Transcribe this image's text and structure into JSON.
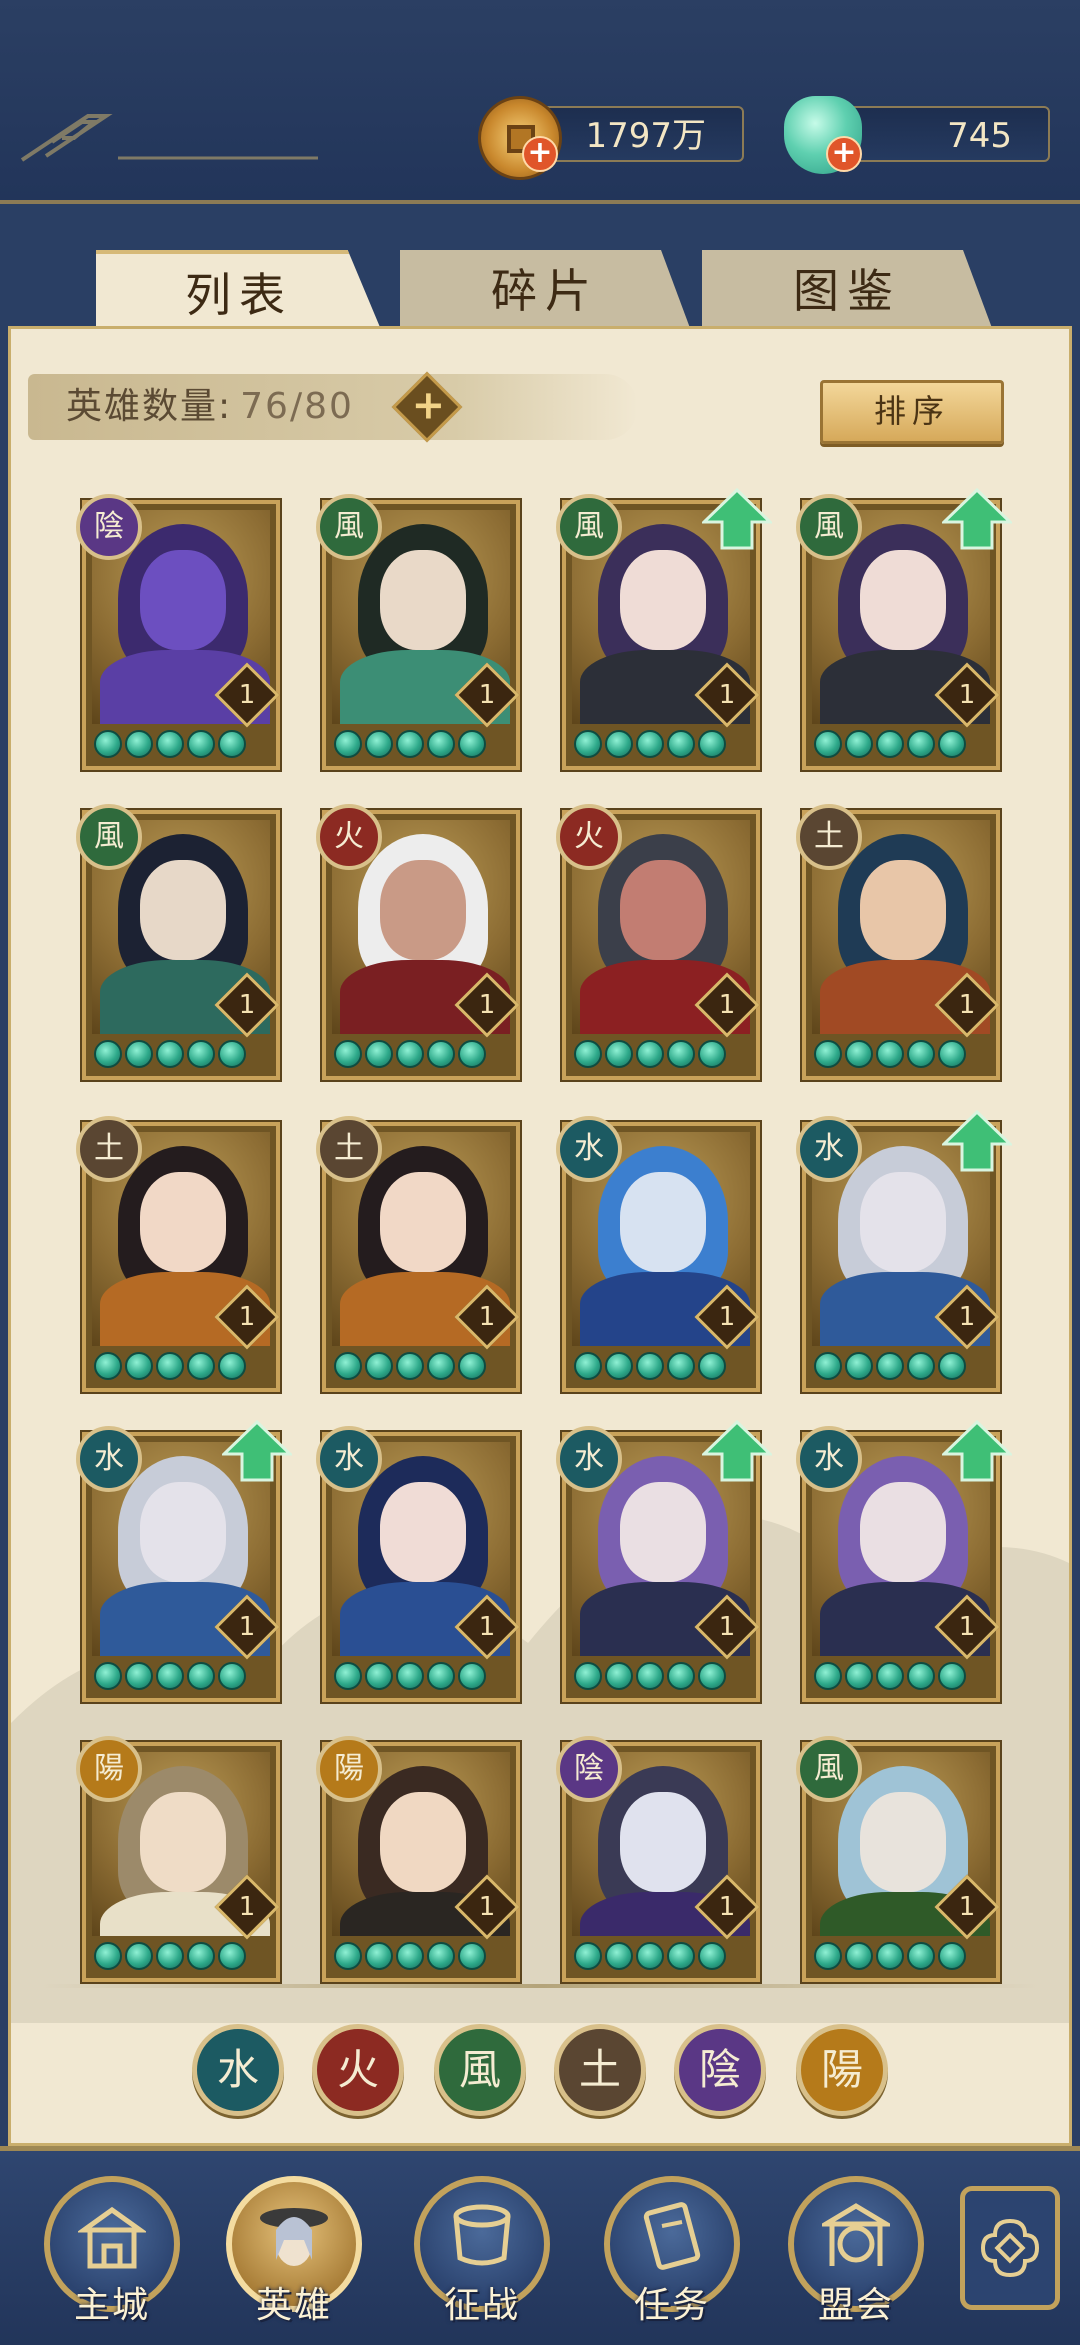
{
  "currency": {
    "coins_value": "1797万",
    "jade_value": "745"
  },
  "tabs": [
    {
      "label": "列表"
    },
    {
      "label": "碎片"
    },
    {
      "label": "图鉴"
    }
  ],
  "hero_count": {
    "label": "英雄数量:",
    "value": "76/80"
  },
  "sort_button": "排序",
  "heroes": [
    {
      "element": "陰",
      "level": "1",
      "stars": 5,
      "can_upgrade": false
    },
    {
      "element": "風",
      "level": "1",
      "stars": 5,
      "can_upgrade": false
    },
    {
      "element": "風",
      "level": "1",
      "stars": 5,
      "can_upgrade": true
    },
    {
      "element": "風",
      "level": "1",
      "stars": 5,
      "can_upgrade": true
    },
    {
      "element": "風",
      "level": "1",
      "stars": 5,
      "can_upgrade": false
    },
    {
      "element": "火",
      "level": "1",
      "stars": 5,
      "can_upgrade": false
    },
    {
      "element": "火",
      "level": "1",
      "stars": 5,
      "can_upgrade": false
    },
    {
      "element": "土",
      "level": "1",
      "stars": 5,
      "can_upgrade": false
    },
    {
      "element": "土",
      "level": "1",
      "stars": 5,
      "can_upgrade": false
    },
    {
      "element": "土",
      "level": "1",
      "stars": 5,
      "can_upgrade": false
    },
    {
      "element": "水",
      "level": "1",
      "stars": 5,
      "can_upgrade": false
    },
    {
      "element": "水",
      "level": "1",
      "stars": 5,
      "can_upgrade": true
    },
    {
      "element": "水",
      "level": "1",
      "stars": 5,
      "can_upgrade": true
    },
    {
      "element": "水",
      "level": "1",
      "stars": 5,
      "can_upgrade": false
    },
    {
      "element": "水",
      "level": "1",
      "stars": 5,
      "can_upgrade": true
    },
    {
      "element": "水",
      "level": "1",
      "stars": 5,
      "can_upgrade": true
    },
    {
      "element": "陽",
      "level": "1",
      "stars": 5,
      "can_upgrade": false
    },
    {
      "element": "陽",
      "level": "1",
      "stars": 5,
      "can_upgrade": false
    },
    {
      "element": "陰",
      "level": "1",
      "stars": 5,
      "can_upgrade": false
    },
    {
      "element": "風",
      "level": "1",
      "stars": 5,
      "can_upgrade": false
    }
  ],
  "element_filters": [
    {
      "glyph": "水",
      "color": "#1c5a62"
    },
    {
      "glyph": "火",
      "color": "#8c2a22"
    },
    {
      "glyph": "風",
      "color": "#2f6a3c"
    },
    {
      "glyph": "土",
      "color": "#5a4632"
    },
    {
      "glyph": "陰",
      "color": "#5a3785"
    },
    {
      "glyph": "陽",
      "color": "#b57a1a"
    }
  ],
  "nav": [
    {
      "label": "主城",
      "icon": "city-gate-icon"
    },
    {
      "label": "英雄",
      "icon": "hero-portrait-icon"
    },
    {
      "label": "征战",
      "icon": "battle-drum-icon"
    },
    {
      "label": "任务",
      "icon": "task-scroll-icon"
    },
    {
      "label": "盟会",
      "icon": "alliance-pavilion-icon"
    }
  ],
  "colors": {
    "header_bg": "#2b3f63",
    "panel_bg": "#f1e8d2",
    "gold_border": "#c9a25a",
    "star_jade": "#2ea98a",
    "upgrade_arrow": "#3fbf76"
  }
}
